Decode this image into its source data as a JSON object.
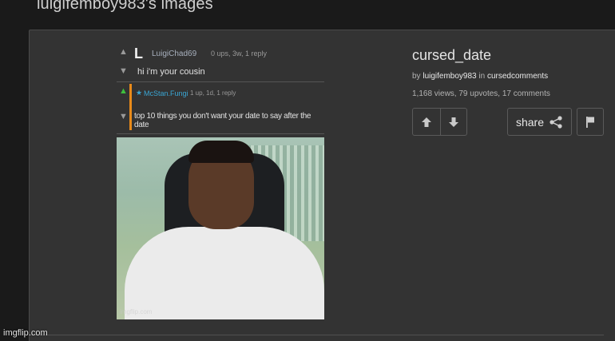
{
  "header": {
    "title": "luigifemboy983's images"
  },
  "post": {
    "title": "cursed_date",
    "by_prefix": "by ",
    "author": "luigifemboy983",
    "in_word": " in ",
    "stream": "cursedcomments",
    "stats": "1,168 views, 79 upvotes, 17 comments"
  },
  "comments": [
    {
      "user": "LuigiChad69",
      "meta": "0 ups, 3w, 1 reply",
      "text": "hi i'm your cousin"
    },
    {
      "user": "McStan.Fungi",
      "meta": "1 up, 1d, 1 reply",
      "text": "top 10 things you don't want your date to say after the date"
    }
  ],
  "actions": {
    "share_label": "share"
  },
  "watermark": "imgflip.com",
  "image_watermark": "imgflip.com",
  "colors": {
    "reply_bar": "#e88a1a",
    "mod_user": "#3aa6d4",
    "upvote_green": "#3ec03e"
  },
  "icons": [
    "upvote-icon",
    "downvote-icon",
    "share-icon",
    "flag-icon"
  ]
}
